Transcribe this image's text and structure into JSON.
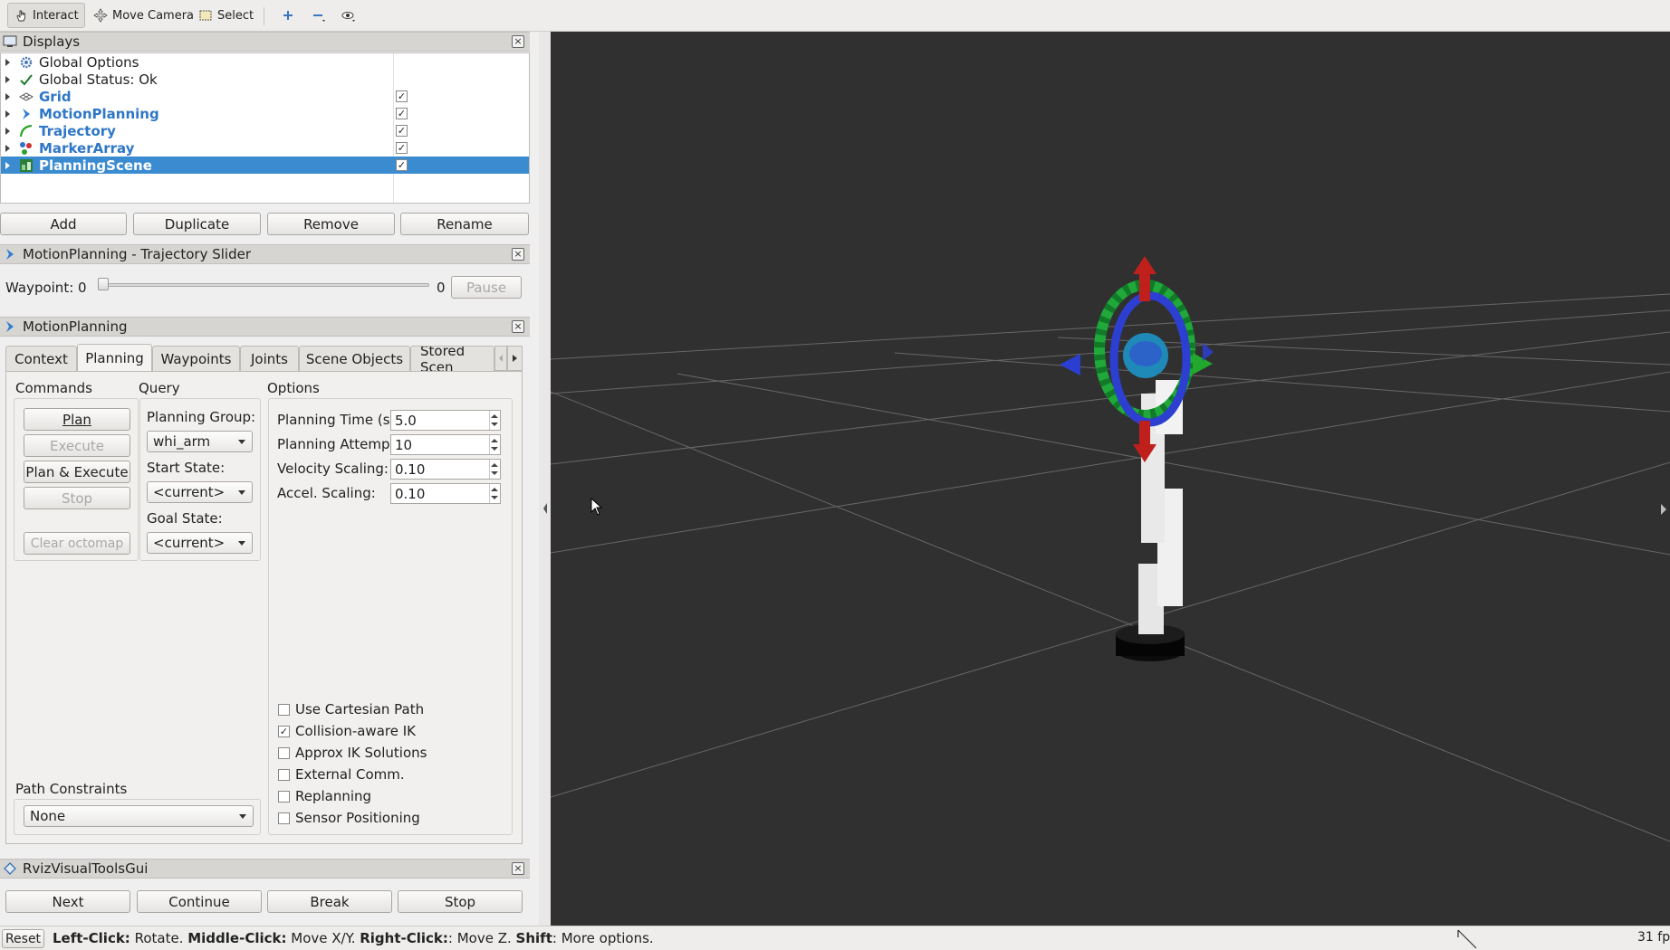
{
  "toolbar": {
    "interact": "Interact",
    "move_camera": "Move Camera",
    "select": "Select"
  },
  "displays": {
    "title": "Displays",
    "items": [
      {
        "label": "Global Options",
        "checked": null
      },
      {
        "label": "Global Status: Ok",
        "checked": null
      },
      {
        "label": "Grid",
        "checked": true
      },
      {
        "label": "MotionPlanning",
        "checked": true
      },
      {
        "label": "Trajectory",
        "checked": true
      },
      {
        "label": "MarkerArray",
        "checked": true
      },
      {
        "label": "PlanningScene",
        "checked": true,
        "selected": true
      }
    ],
    "buttons": {
      "add": "Add",
      "duplicate": "Duplicate",
      "remove": "Remove",
      "rename": "Rename"
    }
  },
  "slider_panel": {
    "title": "MotionPlanning - Trajectory Slider",
    "waypoint_label": "Waypoint: 0",
    "value_max": "0",
    "pause": "Pause",
    "position": 0
  },
  "motion_planning": {
    "title": "MotionPlanning",
    "tabs": [
      "Context",
      "Planning",
      "Waypoints",
      "Joints",
      "Scene Objects",
      "Stored Scen"
    ],
    "active_tab": "Planning",
    "commands": {
      "header": "Commands",
      "plan": "Plan",
      "execute": "Execute",
      "plan_execute": "Plan & Execute",
      "stop": "Stop",
      "clear_octomap": "Clear octomap"
    },
    "query": {
      "header": "Query",
      "planning_group_label": "Planning Group:",
      "planning_group": "whi_arm",
      "start_state_label": "Start State:",
      "start_state": "<current>",
      "goal_state_label": "Goal State:",
      "goal_state": "<current>"
    },
    "options": {
      "header": "Options",
      "planning_time_label": "Planning Time (s):",
      "planning_time": "5.0",
      "planning_attempts_label": "Planning Attempts:",
      "planning_attempts": "10",
      "velocity_scaling_label": "Velocity Scaling:",
      "velocity_scaling": "0.10",
      "accel_scaling_label": "Accel. Scaling:",
      "accel_scaling": "0.10",
      "checkboxes": [
        {
          "label": "Use Cartesian Path",
          "checked": false
        },
        {
          "label": "Collision-aware IK",
          "checked": true
        },
        {
          "label": "Approx IK Solutions",
          "checked": false
        },
        {
          "label": "External Comm.",
          "checked": false
        },
        {
          "label": "Replanning",
          "checked": false
        },
        {
          "label": "Sensor Positioning",
          "checked": false
        }
      ]
    },
    "path_constraints": {
      "label": "Path Constraints",
      "value": "None"
    }
  },
  "rviz_gui": {
    "title": "RvizVisualToolsGui",
    "next": "Next",
    "continue": "Continue",
    "break": "Break",
    "stop": "Stop"
  },
  "status": {
    "reset": "Reset",
    "left_click": "Left-Click:",
    "left_click_text": " Rotate. ",
    "middle_click": "Middle-Click:",
    "middle_click_text": " Move X/Y. ",
    "right_click": "Right-Click:",
    "right_click_text": ": Move Z. ",
    "shift": "Shift",
    "shift_text": ": More options.",
    "fps": "31 fp"
  },
  "colors": {
    "selection": "#3b8bd0",
    "viewport_bg": "#303030",
    "link_blue": "#2e76c6"
  }
}
